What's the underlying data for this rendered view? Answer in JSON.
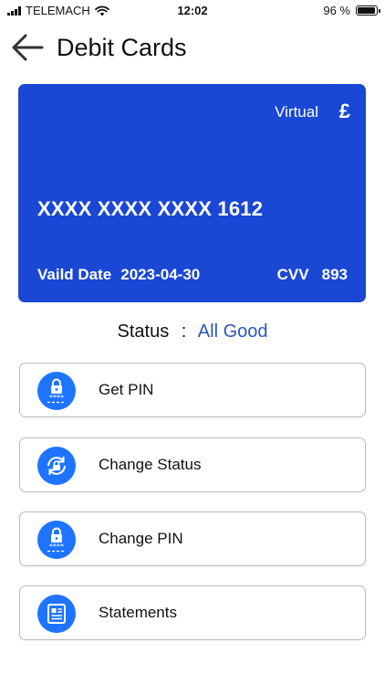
{
  "status_bar": {
    "carrier": "TELEMACH",
    "time": "12:02",
    "battery": "96 %",
    "battery_level": 0.96
  },
  "header": {
    "title": "Debit Cards",
    "back_icon": "arrow-left-icon"
  },
  "card": {
    "type": "Virtual",
    "currency": "£",
    "number": "XXXX XXXX XXXX 1612",
    "valid_label": "Vaild Date",
    "valid_value": "2023-04-30",
    "cvv_label": "CVV",
    "cvv_value": "893",
    "color": "#1a47d4"
  },
  "status": {
    "label": "Status",
    "separator": ":",
    "value": "All Good",
    "value_color": "#2a55c4"
  },
  "actions": [
    {
      "label": "Get PIN",
      "icon": "lock-pin-icon"
    },
    {
      "label": "Change Status",
      "icon": "lock-refresh-icon"
    },
    {
      "label": "Change PIN",
      "icon": "lock-pin-icon"
    },
    {
      "label": "Statements",
      "icon": "document-icon"
    }
  ],
  "colors": {
    "accent": "#1e74ff"
  }
}
